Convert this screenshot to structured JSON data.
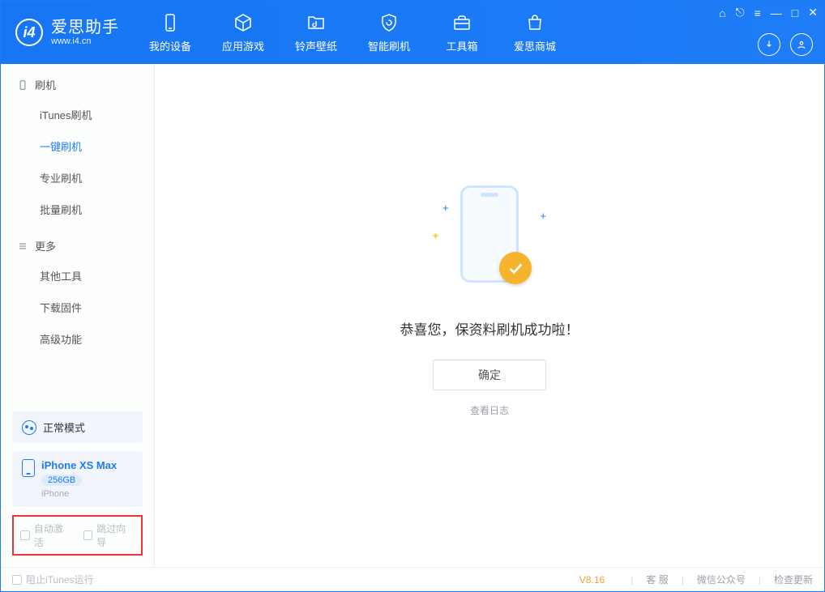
{
  "logo": {
    "title": "爱思助手",
    "subtitle": "www.i4.cn"
  },
  "tabs": [
    {
      "label": "我的设备"
    },
    {
      "label": "应用游戏"
    },
    {
      "label": "铃声壁纸"
    },
    {
      "label": "智能刷机"
    },
    {
      "label": "工具箱"
    },
    {
      "label": "爱思商城"
    }
  ],
  "sidebar": {
    "sections": [
      {
        "title": "刷机",
        "items": [
          {
            "label": "iTunes刷机"
          },
          {
            "label": "一键刷机",
            "active": true
          },
          {
            "label": "专业刷机"
          },
          {
            "label": "批量刷机"
          }
        ]
      },
      {
        "title": "更多",
        "items": [
          {
            "label": "其他工具"
          },
          {
            "label": "下载固件"
          },
          {
            "label": "高级功能"
          }
        ]
      }
    ],
    "mode": "正常模式",
    "device": {
      "name": "iPhone XS Max",
      "capacity": "256GB",
      "type": "iPhone"
    },
    "options": {
      "auto_activate": "自动激活",
      "skip_guide": "跳过向导"
    }
  },
  "main": {
    "message": "恭喜您，保资料刷机成功啦！",
    "ok": "确定",
    "viewlog": "查看日志"
  },
  "status": {
    "block_itunes": "阻止iTunes运行",
    "version": "V8.16",
    "links": {
      "service": "客 服",
      "wechat": "微信公众号",
      "update": "检查更新"
    }
  }
}
